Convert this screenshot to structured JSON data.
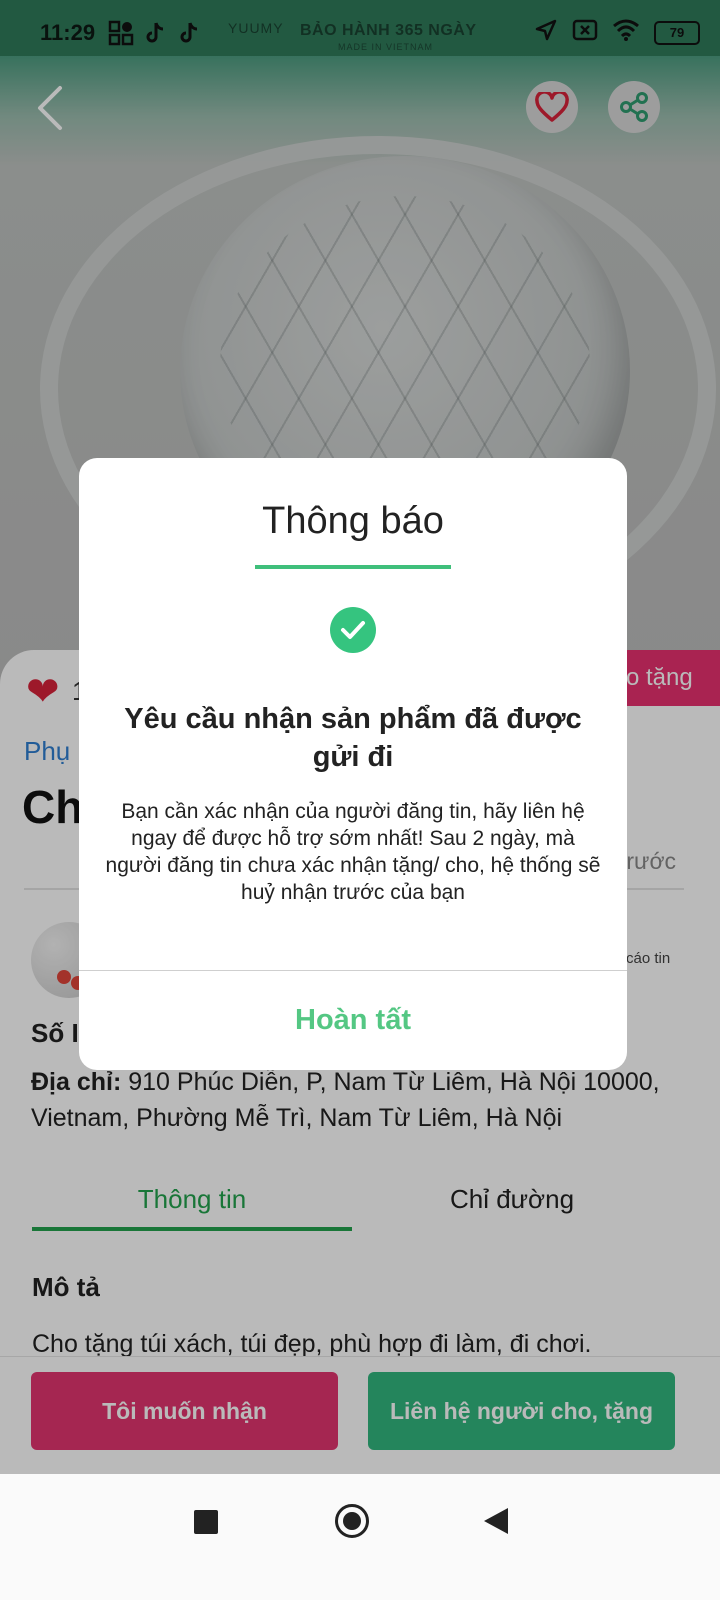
{
  "status_bar": {
    "time": "11:29",
    "battery": "79",
    "brand": "YUUMY",
    "warranty": "BẢO HÀNH 365 NGÀY",
    "warranty_sub": "MADE IN VIETNAM"
  },
  "product": {
    "like_count": "1",
    "gift_label": "o tặng",
    "category": "Phụ",
    "title_fragment": "Ch",
    "posted_fragment": "trước",
    "report_fragment": "cáo tin",
    "phone_label": "Số I",
    "address_label": "Địa chỉ:",
    "address_value": "910 Phúc Diễn, P, Nam Từ Liêm, Hà Nội 10000, Vietnam, Phường Mễ Trì, Nam Từ Liêm, Hà Nội",
    "tabs": [
      {
        "label": "Thông tin",
        "active": true
      },
      {
        "label": "Chỉ đường",
        "active": false
      }
    ],
    "description_heading": "Mô tả",
    "description_text": "Cho tặng túi xách, túi đẹp, phù hợp đi làm, đi chơi."
  },
  "actions": {
    "receive_label": "Tôi muốn nhận",
    "contact_label": "Liên hệ người cho, tặng"
  },
  "modal": {
    "title": "Thông báo",
    "heading": "Yêu cầu nhận sản phẩm đã được gửi đi",
    "body": "Bạn cần xác nhận của người đăng tin, hãy liên hệ ngay để được hỗ trợ sớm nhất! Sau 2 ngày, mà người đăng tin chưa xác nhận tặng/ cho, hệ thống sẽ huỷ nhận trước của bạn",
    "done_label": "Hoàn tất"
  },
  "colors": {
    "primary_green": "#32b77f",
    "accent_pink": "#e2356f",
    "link_blue": "#2f7fd1"
  },
  "icons": [
    "back-arrow-icon",
    "heart-icon",
    "share-icon",
    "check-circle-icon",
    "nav-recents-icon",
    "nav-home-icon",
    "nav-back-icon"
  ]
}
